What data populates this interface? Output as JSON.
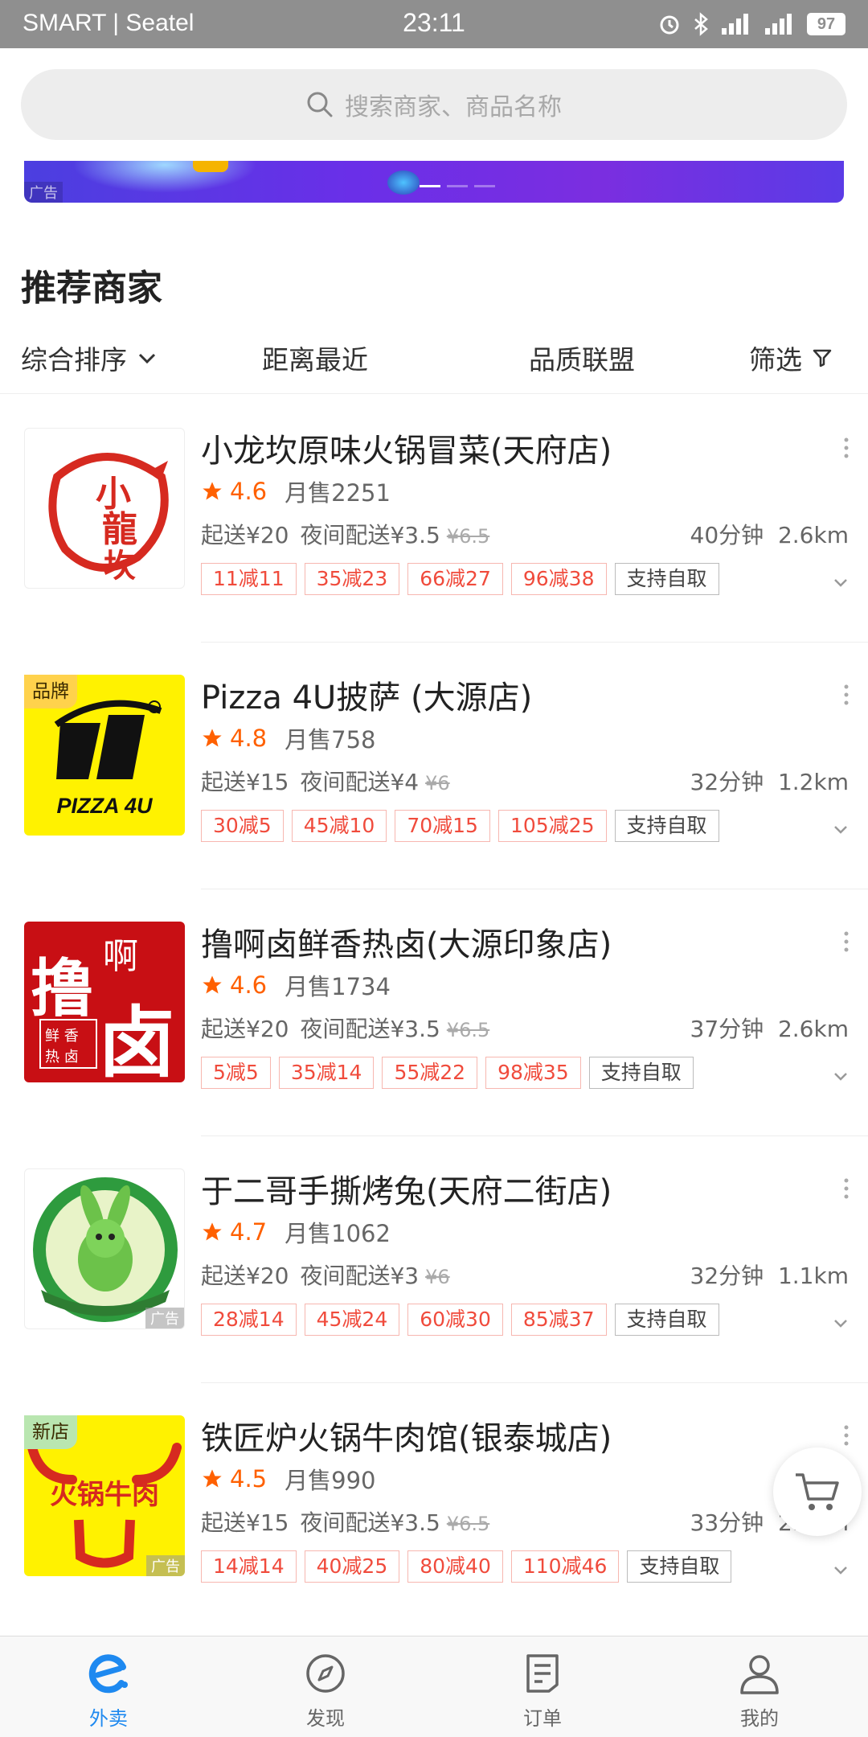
{
  "status_bar": {
    "carrier": "SMART | Seatel",
    "time": "23:11",
    "battery": "97"
  },
  "search": {
    "placeholder": "搜索商家、商品名称"
  },
  "banner": {
    "ad_label": "广告"
  },
  "section": {
    "title": "推荐商家"
  },
  "sort_bar": {
    "items": [
      {
        "label": "综合排序"
      },
      {
        "label": "距离最近"
      },
      {
        "label": "品质联盟"
      },
      {
        "label": "筛选"
      }
    ]
  },
  "shops": [
    {
      "name": "小龙坎原味火锅冒菜(天府店)",
      "score": "4.6",
      "sales": "月售2251",
      "min_order": "起送¥20",
      "night_delivery": "夜间配送¥3.5",
      "orig_fee": "¥6.5",
      "time": "40分钟",
      "distance": "2.6km",
      "tags": [
        "11减11",
        "35减23",
        "66减27",
        "96减38"
      ],
      "pickup": "支持自取"
    },
    {
      "name": "Pizza 4U披萨 (大源店)",
      "badge": "品牌",
      "logo_text": "PIZZA 4U",
      "score": "4.8",
      "sales": "月售758",
      "min_order": "起送¥15",
      "night_delivery": "夜间配送¥4",
      "orig_fee": "¥6",
      "time": "32分钟",
      "distance": "1.2km",
      "tags": [
        "30减5",
        "45减10",
        "70减15",
        "105减25"
      ],
      "pickup": "支持自取"
    },
    {
      "name": "撸啊卤鲜香热卤(大源印象店)",
      "score": "4.6",
      "sales": "月售1734",
      "min_order": "起送¥20",
      "night_delivery": "夜间配送¥3.5",
      "orig_fee": "¥6.5",
      "time": "37分钟",
      "distance": "2.6km",
      "tags": [
        "5减5",
        "35减14",
        "55减22",
        "98减35"
      ],
      "pickup": "支持自取"
    },
    {
      "name": "于二哥手撕烤兔(天府二街店)",
      "ad_label": "广告",
      "score": "4.7",
      "sales": "月售1062",
      "min_order": "起送¥20",
      "night_delivery": "夜间配送¥3",
      "orig_fee": "¥6",
      "time": "32分钟",
      "distance": "1.1km",
      "tags": [
        "28减14",
        "45减24",
        "60减30",
        "85减37"
      ],
      "pickup": "支持自取"
    },
    {
      "name": "铁匠炉火锅牛肉馆(银泰城店)",
      "badge": "新店",
      "ad_label": "广告",
      "logo_text": "火锅牛肉",
      "score": "4.5",
      "sales": "月售990",
      "min_order": "起送¥15",
      "night_delivery": "夜间配送¥3.5",
      "orig_fee": "¥6.5",
      "time": "33分钟",
      "distance": "2.7km",
      "tags": [
        "14减14",
        "40减25",
        "80减40",
        "110减46"
      ],
      "pickup": "支持自取"
    }
  ],
  "bottom_nav": {
    "items": [
      {
        "label": "外卖"
      },
      {
        "label": "发现"
      },
      {
        "label": "订单"
      },
      {
        "label": "我的"
      }
    ],
    "active": "外卖"
  },
  "colors": {
    "accent": "#1e89f0",
    "rating": "#ff6000",
    "promo": "#f04b3c",
    "status_bar": "#8f8f8f"
  },
  "icons": [
    "search-icon",
    "chevron-down-icon",
    "filter-icon",
    "star-icon",
    "more-icon",
    "cart-icon",
    "takeout-icon",
    "compass-icon",
    "order-icon",
    "user-icon"
  ]
}
